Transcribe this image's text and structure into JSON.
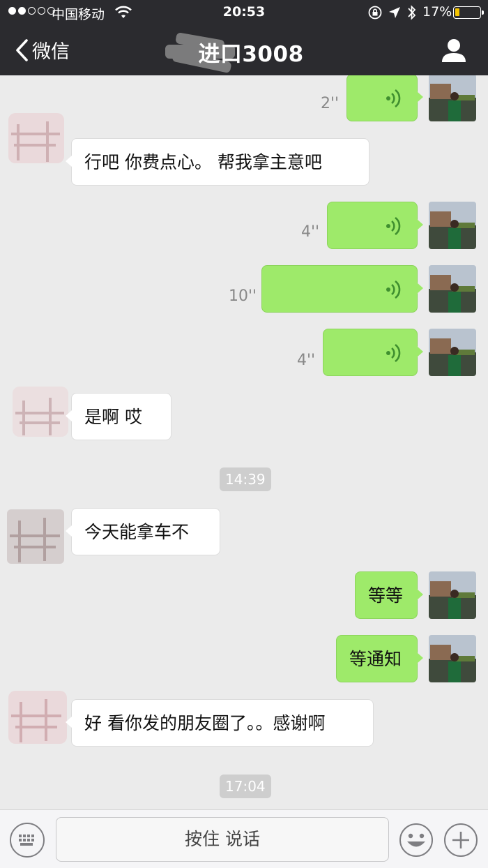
{
  "status_bar": {
    "carrier": "中国移动",
    "time": "20:53",
    "battery_pct": "17%",
    "signal_bars_filled": 2,
    "signal_bars_total": 5,
    "battery_level": 0.17
  },
  "nav": {
    "back_label": "微信",
    "title": "进口3008"
  },
  "messages": [
    {
      "sender": "me",
      "type": "voice",
      "duration": "2''"
    },
    {
      "sender": "them",
      "type": "text",
      "text": "行吧  你费点心。 帮我拿主意吧"
    },
    {
      "sender": "me",
      "type": "voice",
      "duration": "4''"
    },
    {
      "sender": "me",
      "type": "voice",
      "duration": "10''"
    },
    {
      "sender": "me",
      "type": "voice",
      "duration": "4''"
    },
    {
      "sender": "them",
      "type": "text",
      "text": "是啊 哎"
    },
    {
      "type": "timestamp",
      "text": "14:39"
    },
    {
      "sender": "them",
      "type": "text",
      "text": "今天能拿车不"
    },
    {
      "sender": "me",
      "type": "text",
      "text": "等等"
    },
    {
      "sender": "me",
      "type": "text",
      "text": "等通知"
    },
    {
      "sender": "them",
      "type": "text",
      "text": "好  看你发的朋友圈了。。感谢啊"
    },
    {
      "type": "timestamp",
      "text": "17:04"
    }
  ],
  "input_bar": {
    "hold_to_talk_label": "按住 说话"
  },
  "icons": {
    "back": "chevron-left-icon",
    "profile": "person-icon",
    "voice": "voice-wave-icon",
    "keyboard": "keyboard-icon",
    "emoji": "smile-icon",
    "plus": "plus-icon"
  },
  "colors": {
    "nav_bg": "#2b2b2f",
    "chat_bg": "#ebebeb",
    "my_bubble": "#9eea6a",
    "their_bubble": "#ffffff",
    "voice_icon": "#3f8f2f"
  }
}
